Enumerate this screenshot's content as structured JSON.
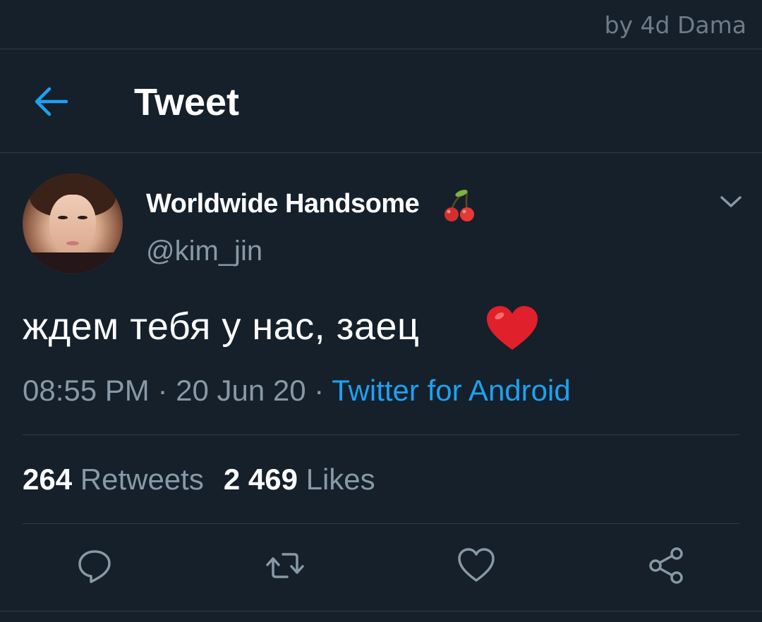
{
  "watermark": "by 4d Dama",
  "header": {
    "title": "Tweet",
    "back_icon": "arrow-left-icon"
  },
  "author": {
    "display_name": "Worldwide Handsome",
    "name_emoji": "cherries-icon",
    "username": "@kim_jin",
    "menu_icon": "chevron-down-icon"
  },
  "tweet": {
    "text": "ждем тебя у нас, заец",
    "text_emoji": "red-heart-icon",
    "time": "08:55 PM",
    "separator": "·",
    "date": "20 Jun 20",
    "source": "Twitter for Android"
  },
  "stats": {
    "retweets_count": "264",
    "retweets_label": "Retweets",
    "likes_count": "2 469",
    "likes_label": "Likes"
  },
  "actions": [
    "reply-icon",
    "retweet-icon",
    "like-icon",
    "share-icon"
  ],
  "colors": {
    "background": "#15202b",
    "accent": "#1da1f2",
    "secondary_text": "#8899a6",
    "divider": "#2f3b48"
  }
}
